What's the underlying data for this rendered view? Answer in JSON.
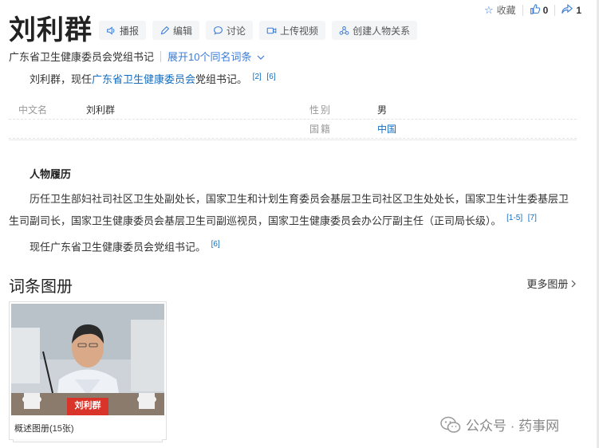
{
  "topbar": {
    "collect_label": "收藏",
    "like_count": "0",
    "share_count": "1"
  },
  "title": "刘利群",
  "toolbar": {
    "broadcast": "播报",
    "edit": "编辑",
    "discuss": "讨论",
    "upload_video": "上传视频",
    "create_relation": "创建人物关系"
  },
  "subtitle": {
    "description": "广东省卫生健康委员会党组书记",
    "expand": "展开10个同名词条"
  },
  "intro": {
    "prefix": "刘利群，现任",
    "link": "广东省卫生健康委员会",
    "suffix": "党组书记。",
    "refs": [
      "[2]",
      "[6]"
    ]
  },
  "infobox": {
    "chinese_name_key": "中文名",
    "chinese_name_val": "刘利群",
    "gender_key": "性别",
    "gender_val": "男",
    "nationality_key": "国籍",
    "nationality_val": "中国"
  },
  "career": {
    "heading": "人物履历",
    "para1": "历任卫生部妇社司社区卫生处副处长，国家卫生和计划生育委员会基层卫生司社区卫生处处长，国家卫生计生委基层卫生司副司长，国家卫生健康委员会基层卫生司副巡视员，国家卫生健康委员会办公厅副主任（正司局长级）。",
    "para1_refs": [
      "[1-5]",
      "[7]"
    ],
    "para2": "现任广东省卫生健康委员会党组书记。",
    "para2_refs": [
      "[6]"
    ]
  },
  "album": {
    "heading": "词条图册",
    "more": "更多图册",
    "card_label": "概述图册(15张)",
    "nameplate": "刘利群"
  },
  "watermark": {
    "text": "公众号 · 药事网"
  },
  "colors": {
    "link": "#136ec2",
    "accent": "#3b7bd6",
    "nameplate": "#d8342a"
  }
}
